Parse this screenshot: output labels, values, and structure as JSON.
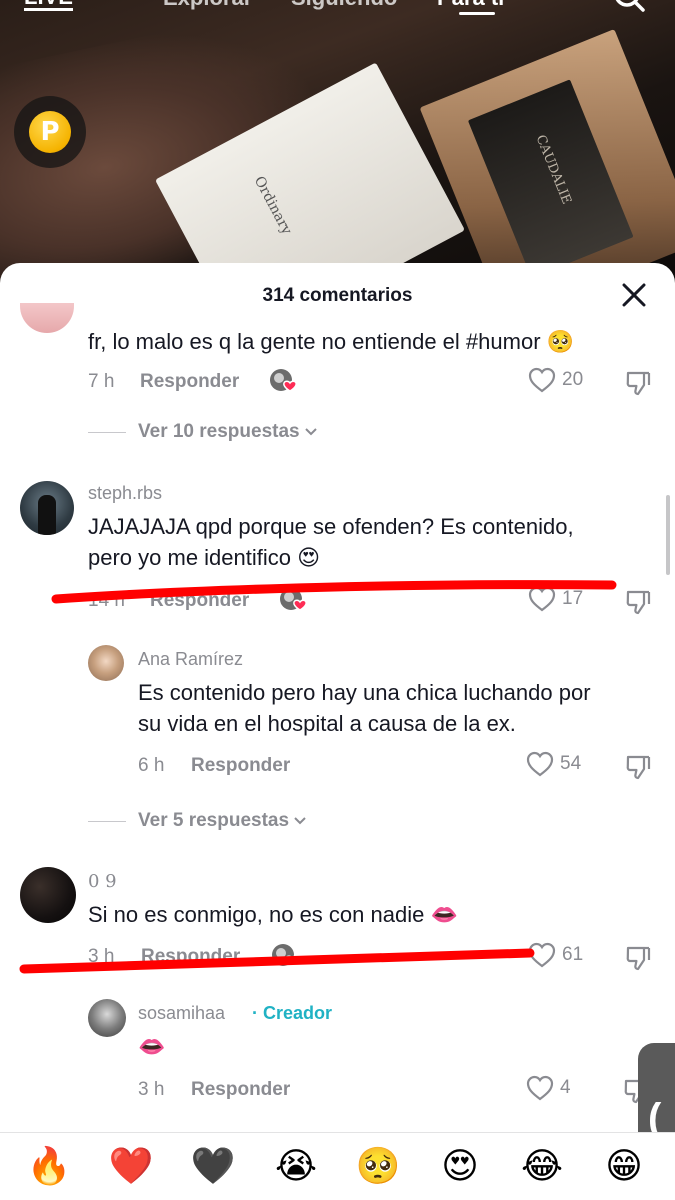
{
  "top_nav": {
    "live": "LIVE",
    "tabs": [
      "Explorar",
      "Siguiendo",
      "Para ti"
    ],
    "active_tab": "Para ti"
  },
  "coin_label": "P",
  "video": {
    "box_label_1": "Ordinary",
    "box_label_2": "CAUDALIE"
  },
  "sheet": {
    "title": "314 comentarios",
    "comments": [
      {
        "text": "fr, lo malo es q la gente no entiende el #humor",
        "emoji": "🥺",
        "time": "7 h",
        "reply_label": "Responder",
        "likes": "20",
        "view_replies": "Ver 10 respuestas"
      },
      {
        "username": "steph.rbs",
        "text_line1": "JAJAJAJA qpd porque se ofenden? Es contenido,",
        "text_line2": "pero yo me identifico",
        "emoji": "😍",
        "time": "14 h",
        "reply_label": "Responder",
        "likes": "17"
      },
      {
        "username": "Ana Ramírez",
        "text_line1": "Es contenido pero hay una chica luchando por",
        "text_line2": "su vida en el hospital a causa de la ex.",
        "time": "6 h",
        "reply_label": "Responder",
        "likes": "54",
        "view_replies": "Ver 5 respuestas"
      },
      {
        "username": "0 9",
        "text": "Si no es conmigo, no es con nadie",
        "emoji": "👄",
        "time": "3 h",
        "reply_label": "Responder",
        "likes": "61"
      },
      {
        "username": "sosamihaa",
        "creator_tag": "· Creador",
        "emoji": "👄",
        "time": "3 h",
        "reply_label": "Responder",
        "likes": "4"
      }
    ]
  },
  "side_tab": "(",
  "emoji_bar": [
    "🔥",
    "❤️",
    "🖤",
    "😭",
    "🥺",
    "😍",
    "😂",
    "😁"
  ],
  "colors": {
    "accent_red": "#fe2c55",
    "creator_teal": "#20b2c4",
    "annotation_red": "#ff0000"
  }
}
